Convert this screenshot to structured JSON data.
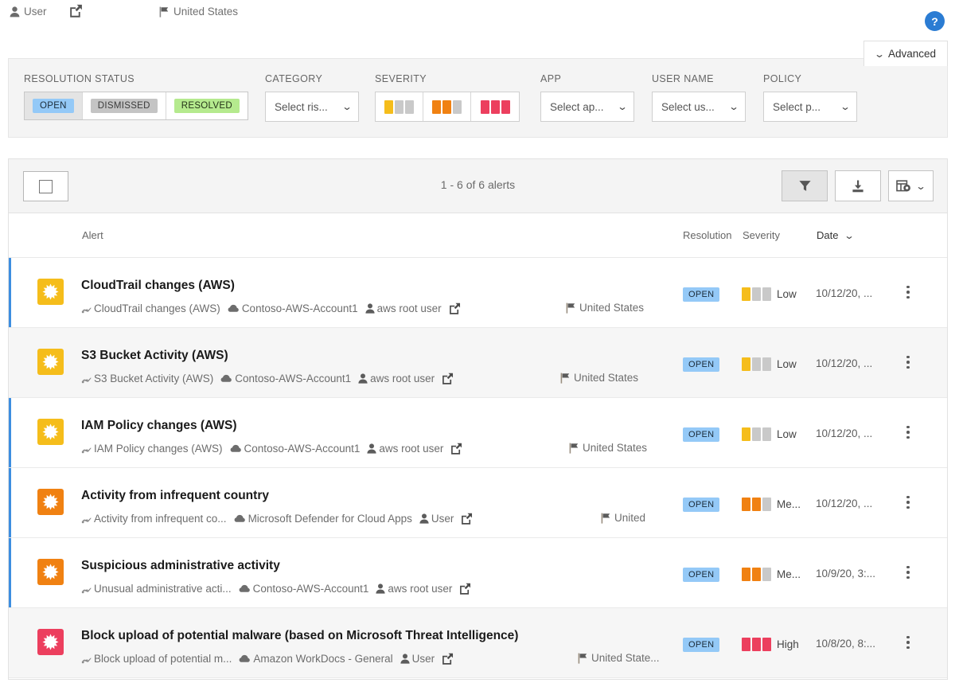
{
  "breadcrumb": {
    "user_label": "User",
    "country_label": "United States",
    "user_icon": "person-icon",
    "external_link_icon": "external-link-icon",
    "flag_icon": "flag-icon"
  },
  "help": {
    "label": "?",
    "icon": "help-icon",
    "color": "#2b7cd3"
  },
  "filters": {
    "advanced_label": "Advanced",
    "resolution_status": {
      "label": "RESOLUTION STATUS",
      "options": [
        {
          "label": "OPEN",
          "state": "open",
          "selected": true
        },
        {
          "label": "DISMISSED",
          "state": "dismissed",
          "selected": false
        },
        {
          "label": "RESOLVED",
          "state": "resolved",
          "selected": false
        }
      ]
    },
    "category": {
      "label": "CATEGORY",
      "placeholder": "Select ris..."
    },
    "severity": {
      "label": "SEVERITY",
      "levels": [
        {
          "name": "low",
          "filled": 1,
          "color": "#f5bd1b"
        },
        {
          "name": "medium",
          "filled": 2,
          "color": "#f08112"
        },
        {
          "name": "high",
          "filled": 3,
          "color": "#ec3f5e"
        }
      ]
    },
    "app": {
      "label": "APP",
      "placeholder": "Select ap..."
    },
    "user_name": {
      "label": "USER NAME",
      "placeholder": "Select us..."
    },
    "policy": {
      "label": "POLICY",
      "placeholder": "Select p..."
    }
  },
  "toolbar": {
    "count_text": "1 - 6 of 6 alerts",
    "select_all_icon": "checkbox-icon",
    "filter_icon": "funnel-icon",
    "export_icon": "download-icon",
    "columns_icon": "table-settings-icon"
  },
  "table": {
    "columns": {
      "alert": "Alert",
      "resolution": "Resolution",
      "severity": "Severity",
      "date": "Date"
    },
    "sort": {
      "column": "Date",
      "direction": "desc"
    },
    "rows": [
      {
        "title": "CloudTrail changes (AWS)",
        "policy": "CloudTrail changes (AWS)",
        "app": "Contoso-AWS-Account1",
        "user": "aws root user",
        "country": "United States",
        "country_offset": 700,
        "status": "OPEN",
        "severity": "Low",
        "severity_level": 1,
        "severity_color": "#f5bd1b",
        "date": "10/12/20, ...",
        "icon_color": "#f5bd1b",
        "alt": false
      },
      {
        "title": "S3 Bucket Activity (AWS)",
        "policy": "S3 Bucket Activity (AWS)",
        "app": "Contoso-AWS-Account1",
        "user": "aws root user",
        "country": "United States",
        "country_offset": 693,
        "status": "OPEN",
        "severity": "Low",
        "severity_level": 1,
        "severity_color": "#f5bd1b",
        "date": "10/12/20, ...",
        "icon_color": "#f5bd1b",
        "alt": true
      },
      {
        "title": "IAM Policy changes (AWS)",
        "policy": "IAM Policy changes (AWS)",
        "app": "Contoso-AWS-Account1",
        "user": "aws root user",
        "country": "United States",
        "country_offset": 704,
        "status": "OPEN",
        "severity": "Low",
        "severity_level": 1,
        "severity_color": "#f5bd1b",
        "date": "10/12/20, ...",
        "icon_color": "#f5bd1b",
        "alt": false
      },
      {
        "title": "Activity from infrequent country",
        "policy": "Activity from infrequent co...",
        "app": "Microsoft Defender for Cloud Apps",
        "user": "User",
        "country": "United",
        "country_offset": 744,
        "status": "OPEN",
        "severity": "Me...",
        "severity_level": 2,
        "severity_color": "#f08112",
        "date": "10/12/20, ...",
        "icon_color": "#f08112",
        "alt": false
      },
      {
        "title": "Suspicious administrative activity",
        "policy": "Unusual administrative acti...",
        "app": "Contoso-AWS-Account1",
        "user": "aws root user",
        "country": "",
        "country_offset": 744,
        "status": "OPEN",
        "severity": "Me...",
        "severity_level": 2,
        "severity_color": "#f08112",
        "date": "10/9/20, 3:...",
        "icon_color": "#f08112",
        "alt": false
      },
      {
        "title": "Block upload of potential malware (based on Microsoft Threat Intelligence)",
        "policy": "Block upload of potential m...",
        "app": "Amazon WorkDocs - General",
        "user": "User",
        "country": "United State...",
        "country_offset": 715,
        "status": "OPEN",
        "severity": "High",
        "severity_level": 3,
        "severity_color": "#ec3f5e",
        "date": "10/8/20, 8:...",
        "icon_color": "#ec3f5e",
        "alt": true
      }
    ]
  }
}
